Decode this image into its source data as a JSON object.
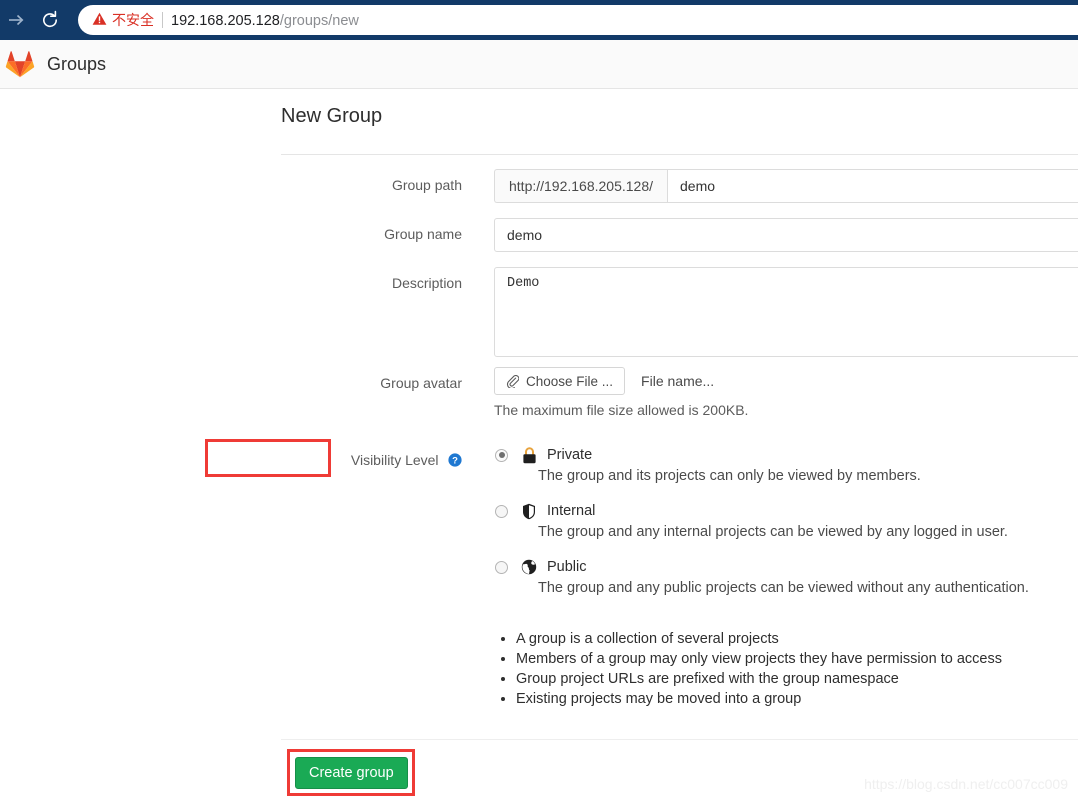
{
  "browser": {
    "forward_icon": "forward-arrow-icon",
    "reload_icon": "reload-icon",
    "security_label": "不安全",
    "warning_icon": "warning-triangle-icon",
    "url_host": "192.168.205.128",
    "url_path": "/groups/new",
    "chrome_color": "#123a68",
    "security_color": "#d93025"
  },
  "header": {
    "logo_icon": "gitlab-tanuki-logo",
    "title": "Groups"
  },
  "form": {
    "title": "New Group",
    "group_path": {
      "label": "Group path",
      "prefix": "http://192.168.205.128/",
      "value": "demo",
      "placeholder": ""
    },
    "group_name": {
      "label": "Group name",
      "value": "demo",
      "placeholder": ""
    },
    "description": {
      "label": "Description",
      "value": "Demo",
      "placeholder": ""
    },
    "group_avatar": {
      "label": "Group avatar",
      "choose_file_label": "Choose File ...",
      "choose_file_icon": "paperclip-icon",
      "file_name_text": "File name...",
      "hint": "The maximum file size allowed is 200KB."
    },
    "visibility": {
      "label": "Visibility Level",
      "help_icon": "question-mark-help-icon",
      "selected": "private",
      "options": [
        {
          "id": "private",
          "icon": "lock-icon",
          "name": "Private",
          "description": "The group and its projects can only be viewed by members.",
          "checked": true
        },
        {
          "id": "internal",
          "icon": "shield-icon",
          "name": "Internal",
          "description": "The group and any internal projects can be viewed by any logged in user.",
          "checked": false
        },
        {
          "id": "public",
          "icon": "globe-icon",
          "name": "Public",
          "description": "The group and any public projects can be viewed without any authentication.",
          "checked": false
        }
      ],
      "facts": [
        "A group is a collection of several projects",
        "Members of a group may only view projects they have permission to access",
        "Group project URLs are prefixed with the group namespace",
        "Existing projects may be moved into a group"
      ]
    },
    "submit_label": "Create group",
    "submit_color": "#1aaa55"
  },
  "annotations": {
    "highlight_color": "#ef3b36"
  },
  "watermark": "https://blog.csdn.net/cc007cc009"
}
